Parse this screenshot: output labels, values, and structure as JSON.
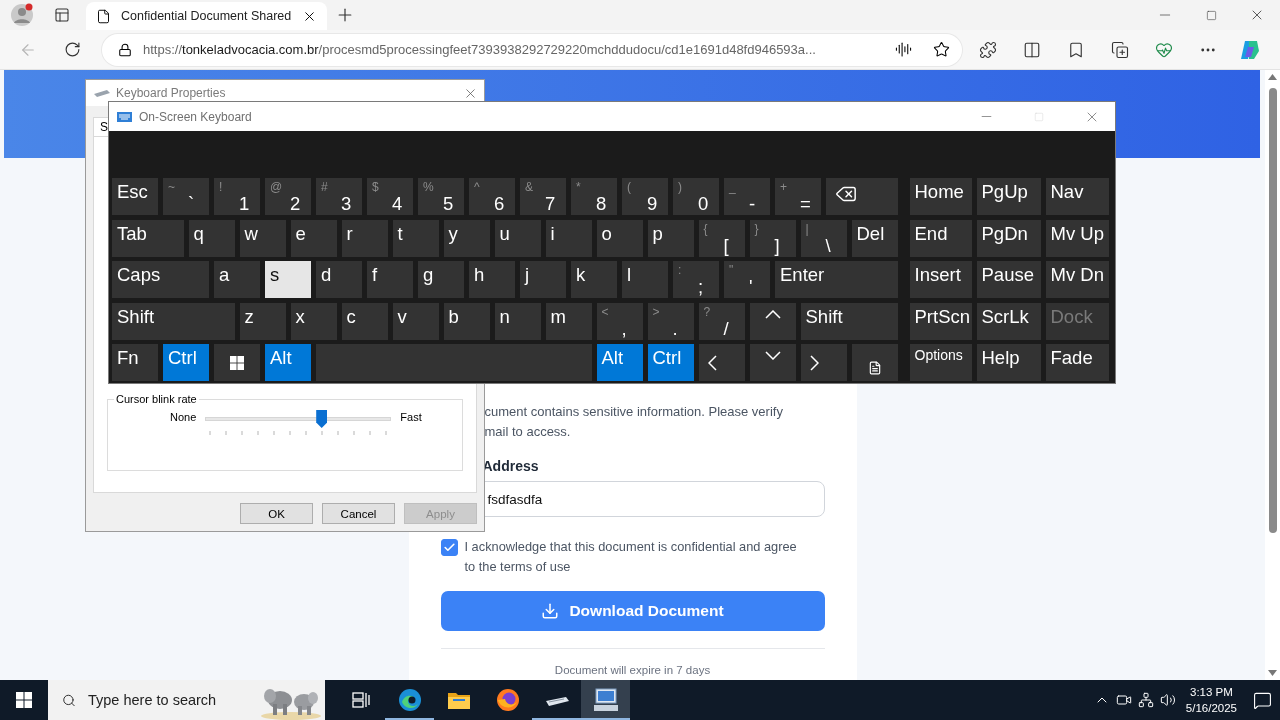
{
  "browser": {
    "tab": {
      "title": "Confidential Document Shared"
    },
    "address": {
      "scheme": "https://",
      "host": "tonkeladvocacia.com.br",
      "path": "/procesmd5processingfeet7393938292729220mchddudocu/cd1e1691d48fd946593a..."
    }
  },
  "page": {
    "description_lines": [
      "cument contains sensitive information. Please verify",
      "mail to access."
    ],
    "email_label": "Address",
    "email_value": "fsdfasdfa",
    "acknowledge": {
      "checked": true,
      "text": "I acknowledge that this document is confidential and agree to the terms of use"
    },
    "download_button": "Download Document",
    "footer": "Document will expire in 7 days"
  },
  "keyboard_properties": {
    "title": "Keyboard Properties",
    "tabs": [
      {
        "label": "S",
        "selected": true
      }
    ],
    "group_title": "Cursor blink rate",
    "slider": {
      "min_label": "None",
      "max_label": "Fast",
      "level": 0.63
    },
    "buttons": [
      {
        "label": "OK",
        "disabled": false
      },
      {
        "label": "Cancel",
        "disabled": false
      },
      {
        "label": "Apply",
        "disabled": true
      }
    ]
  },
  "osk": {
    "title": "On-Screen Keyboard",
    "rows": [
      [
        {
          "kind": "text",
          "label": "Esc",
          "pressed": false,
          "hovered": false
        },
        {
          "kind": "dual",
          "label": "`",
          "shift": "~",
          "pressed": false,
          "hovered": false
        },
        {
          "kind": "dual",
          "label": "1",
          "shift": "!",
          "pressed": false,
          "hovered": false
        },
        {
          "kind": "dual",
          "label": "2",
          "shift": "@",
          "pressed": false,
          "hovered": false
        },
        {
          "kind": "dual",
          "label": "3",
          "shift": "#",
          "pressed": false,
          "hovered": false
        },
        {
          "kind": "dual",
          "label": "4",
          "shift": "$",
          "pressed": false,
          "hovered": false
        },
        {
          "kind": "dual",
          "label": "5",
          "shift": "%",
          "pressed": false,
          "hovered": false
        },
        {
          "kind": "dual",
          "label": "6",
          "shift": "^",
          "pressed": false,
          "hovered": false
        },
        {
          "kind": "dual",
          "label": "7",
          "shift": "&",
          "pressed": false,
          "hovered": false
        },
        {
          "kind": "dual",
          "label": "8",
          "shift": "*",
          "pressed": false,
          "hovered": false
        },
        {
          "kind": "dual",
          "label": "9",
          "shift": "(",
          "pressed": false,
          "hovered": false
        },
        {
          "kind": "dual",
          "label": "0",
          "shift": ")",
          "pressed": false,
          "hovered": false
        },
        {
          "kind": "dual",
          "label": "-",
          "shift": "_",
          "pressed": false,
          "hovered": false
        },
        {
          "kind": "dual",
          "label": "=",
          "shift": "+",
          "pressed": false,
          "hovered": false
        },
        {
          "kind": "backspace",
          "pressed": false,
          "hovered": false
        }
      ],
      [
        {
          "kind": "text",
          "label": "Tab",
          "pressed": false,
          "hovered": false
        },
        {
          "kind": "text",
          "label": "q",
          "pressed": false,
          "hovered": false
        },
        {
          "kind": "text",
          "label": "w",
          "pressed": false,
          "hovered": false
        },
        {
          "kind": "text",
          "label": "e",
          "pressed": false,
          "hovered": false
        },
        {
          "kind": "text",
          "label": "r",
          "pressed": false,
          "hovered": false
        },
        {
          "kind": "text",
          "label": "t",
          "pressed": false,
          "hovered": false
        },
        {
          "kind": "text",
          "label": "y",
          "pressed": false,
          "hovered": false
        },
        {
          "kind": "text",
          "label": "u",
          "pressed": false,
          "hovered": false
        },
        {
          "kind": "text",
          "label": "i",
          "pressed": false,
          "hovered": false
        },
        {
          "kind": "text",
          "label": "o",
          "pressed": false,
          "hovered": false
        },
        {
          "kind": "text",
          "label": "p",
          "pressed": false,
          "hovered": false
        },
        {
          "kind": "dual",
          "label": "[",
          "shift": "{",
          "pressed": false,
          "hovered": false
        },
        {
          "kind": "dual",
          "label": "]",
          "shift": "}",
          "pressed": false,
          "hovered": false
        },
        {
          "kind": "dual",
          "label": "\\",
          "shift": "|",
          "pressed": false,
          "hovered": false
        },
        {
          "kind": "text",
          "label": "Del",
          "pressed": false,
          "hovered": false
        }
      ],
      [
        {
          "kind": "text",
          "label": "Caps",
          "pressed": false,
          "hovered": false
        },
        {
          "kind": "text",
          "label": "a",
          "pressed": false,
          "hovered": false
        },
        {
          "kind": "text",
          "label": "s",
          "pressed": false,
          "hovered": true
        },
        {
          "kind": "text",
          "label": "d",
          "pressed": false,
          "hovered": false
        },
        {
          "kind": "text",
          "label": "f",
          "pressed": false,
          "hovered": false
        },
        {
          "kind": "text",
          "label": "g",
          "pressed": false,
          "hovered": false
        },
        {
          "kind": "text",
          "label": "h",
          "pressed": false,
          "hovered": false
        },
        {
          "kind": "text",
          "label": "j",
          "pressed": false,
          "hovered": false
        },
        {
          "kind": "text",
          "label": "k",
          "pressed": false,
          "hovered": false
        },
        {
          "kind": "text",
          "label": "l",
          "pressed": false,
          "hovered": false
        },
        {
          "kind": "dual",
          "label": ";",
          "shift": ":",
          "pressed": false,
          "hovered": false
        },
        {
          "kind": "dual",
          "label": "'",
          "shift": "\"",
          "pressed": false,
          "hovered": false
        },
        {
          "kind": "text",
          "label": "Enter",
          "pressed": false,
          "hovered": false
        }
      ],
      [
        {
          "kind": "text",
          "label": "Shift",
          "pressed": false,
          "hovered": false
        },
        {
          "kind": "text",
          "label": "z",
          "pressed": false,
          "hovered": false
        },
        {
          "kind": "text",
          "label": "x",
          "pressed": false,
          "hovered": false
        },
        {
          "kind": "text",
          "label": "c",
          "pressed": false,
          "hovered": false
        },
        {
          "kind": "text",
          "label": "v",
          "pressed": false,
          "hovered": false
        },
        {
          "kind": "text",
          "label": "b",
          "pressed": false,
          "hovered": false
        },
        {
          "kind": "text",
          "label": "n",
          "pressed": false,
          "hovered": false
        },
        {
          "kind": "text",
          "label": "m",
          "pressed": false,
          "hovered": false
        },
        {
          "kind": "dual",
          "label": ",",
          "shift": "<",
          "pressed": false,
          "hovered": false
        },
        {
          "kind": "dual",
          "label": ".",
          "shift": ">",
          "pressed": false,
          "hovered": false
        },
        {
          "kind": "dual",
          "label": "/",
          "shift": "?",
          "pressed": false,
          "hovered": false
        },
        {
          "kind": "up",
          "pressed": false,
          "hovered": false
        },
        {
          "kind": "text",
          "label": "Shift",
          "pressed": false,
          "hovered": false
        }
      ],
      [
        {
          "kind": "text",
          "label": "Fn",
          "pressed": false,
          "hovered": false
        },
        {
          "kind": "text",
          "label": "Ctrl",
          "pressed": true,
          "hovered": false
        },
        {
          "kind": "windows",
          "pressed": false,
          "hovered": false
        },
        {
          "kind": "text",
          "label": "Alt",
          "pressed": true,
          "hovered": false
        },
        {
          "kind": "space",
          "pressed": false,
          "hovered": false
        },
        {
          "kind": "text",
          "label": "Alt",
          "pressed": true,
          "hovered": false
        },
        {
          "kind": "text",
          "label": "Ctrl",
          "pressed": true,
          "hovered": false
        },
        {
          "kind": "left",
          "pressed": false,
          "hovered": false
        },
        {
          "kind": "down",
          "pressed": false,
          "hovered": false
        },
        {
          "kind": "right",
          "pressed": false,
          "hovered": false
        },
        {
          "kind": "menu",
          "pressed": false,
          "hovered": false
        }
      ]
    ],
    "nav": [
      [
        {
          "kind": "text",
          "label": "Home",
          "disabled": false
        },
        {
          "kind": "text",
          "label": "PgUp",
          "disabled": false
        },
        {
          "kind": "text",
          "label": "Nav",
          "disabled": false
        }
      ],
      [
        {
          "kind": "text",
          "label": "End",
          "disabled": false
        },
        {
          "kind": "text",
          "label": "PgDn",
          "disabled": false
        },
        {
          "kind": "text",
          "label": "Mv Up",
          "disabled": false
        }
      ],
      [
        {
          "kind": "text",
          "label": "Insert",
          "disabled": false
        },
        {
          "kind": "text",
          "label": "Pause",
          "disabled": false
        },
        {
          "kind": "text",
          "label": "Mv Dn",
          "disabled": false
        }
      ],
      [
        {
          "kind": "text",
          "label": "PrtScn",
          "disabled": false
        },
        {
          "kind": "text",
          "label": "ScrLk",
          "disabled": false
        },
        {
          "kind": "text",
          "label": "Dock",
          "disabled": true
        }
      ],
      [
        {
          "kind": "small",
          "label": "Options",
          "disabled": false
        },
        {
          "kind": "text",
          "label": "Help",
          "disabled": false
        },
        {
          "kind": "text",
          "label": "Fade",
          "disabled": false
        }
      ]
    ]
  },
  "taskbar": {
    "search_placeholder": "Type here to search",
    "apps": [
      {
        "kind": "taskview",
        "running": false,
        "selected": false
      },
      {
        "kind": "edge",
        "running": true,
        "selected": false
      },
      {
        "kind": "explorer",
        "running": false,
        "selected": false
      },
      {
        "kind": "firefox",
        "running": false,
        "selected": false
      },
      {
        "kind": "osk",
        "running": true,
        "selected": false
      },
      {
        "kind": "props",
        "running": true,
        "selected": true
      }
    ],
    "time": "3:13 PM",
    "date": "5/16/2025"
  }
}
